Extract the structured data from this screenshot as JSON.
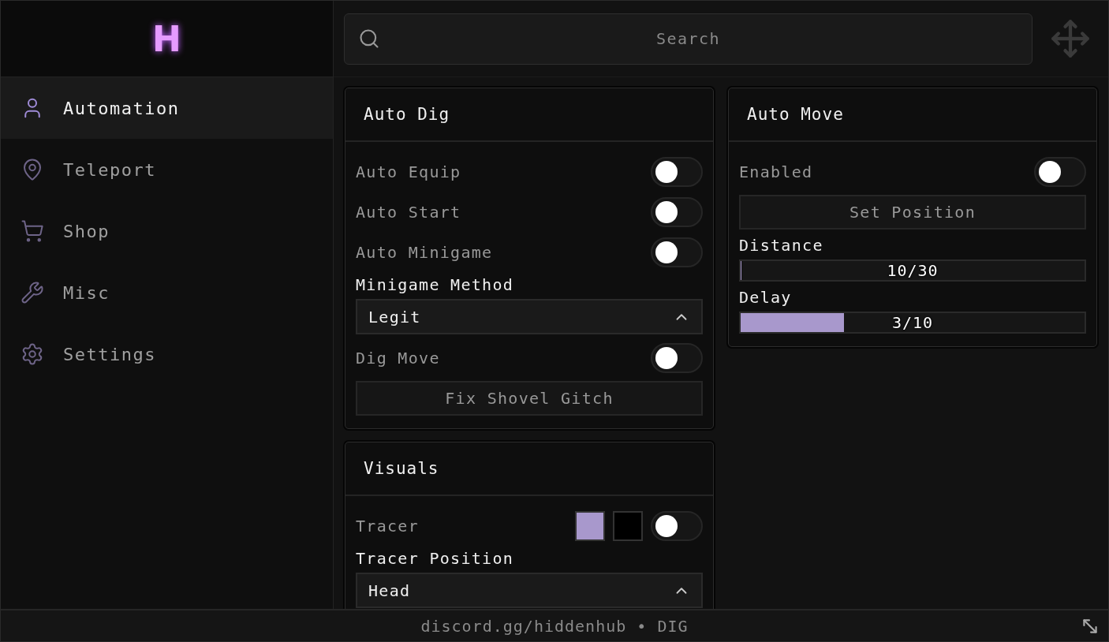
{
  "logo": {
    "text": "H"
  },
  "sidebar": {
    "items": [
      {
        "label": "Automation",
        "selected": true
      },
      {
        "label": "Teleport",
        "selected": false
      },
      {
        "label": "Shop",
        "selected": false
      },
      {
        "label": "Misc",
        "selected": false
      },
      {
        "label": "Settings",
        "selected": false
      }
    ]
  },
  "search": {
    "placeholder": "Search"
  },
  "columns": [
    {
      "cards": [
        {
          "title": "Auto Dig",
          "items": [
            {
              "kind": "toggle",
              "label": "Auto Equip",
              "on": false
            },
            {
              "kind": "toggle",
              "label": "Auto Start",
              "on": false
            },
            {
              "kind": "toggle",
              "label": "Auto Minigame",
              "on": false
            },
            {
              "kind": "dropdown",
              "label": "Minigame Method",
              "value": "Legit"
            },
            {
              "kind": "toggle",
              "label": "Dig Move",
              "on": false
            },
            {
              "kind": "button",
              "label": "Fix Shovel Gitch"
            }
          ]
        },
        {
          "title": "Visuals",
          "items": [
            {
              "kind": "toggle",
              "label": "Tracer",
              "on": false,
              "swatches": [
                {
                  "color": "#a898cc"
                },
                {
                  "color": "#000000"
                }
              ]
            },
            {
              "kind": "dropdown",
              "label": "Tracer Position",
              "value": "Head"
            }
          ]
        }
      ]
    },
    {
      "cards": [
        {
          "title": "Auto Move",
          "items": [
            {
              "kind": "toggle",
              "label": "Enabled",
              "on": false
            },
            {
              "kind": "button",
              "label": "Set Position"
            },
            {
              "kind": "slider",
              "label": "Distance",
              "reading": "10/30",
              "level": 0
            },
            {
              "kind": "slider",
              "label": "Delay",
              "reading": "3/10",
              "level": 0.3
            }
          ]
        }
      ]
    }
  ],
  "footer": {
    "text": "discord.gg/hiddenhub • DIG"
  }
}
